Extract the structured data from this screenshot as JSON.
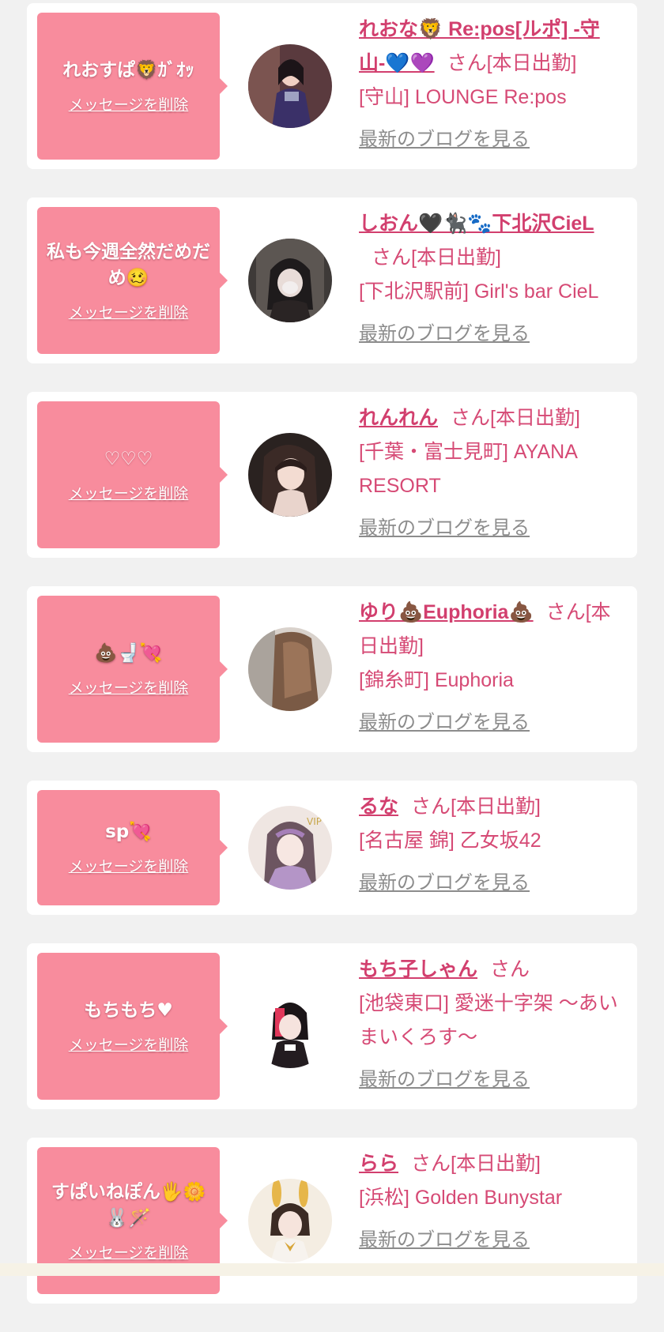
{
  "colors": {
    "bubble": "#f88c9d",
    "accent_pink": "#d64a75",
    "blog_link": "#8c8c8c",
    "card": "#ffffff",
    "page_bg": "#f1f1f1"
  },
  "delete_label": "メッセージを削除",
  "blog_label": "最新のブログを見る",
  "san_label": "さん",
  "cards": [
    {
      "message": "れおすぱ🦁ｶﾞｵｯ",
      "name": "れおな🦁 Re:pos[ルポ] -守山-💙💜",
      "status": "[本日出勤]",
      "shop": "[守山] LOUNGE Re:pos",
      "avatar_icon": "cast-photo-icon"
    },
    {
      "message": "私も今週全然だめだめ🥴",
      "name": "しおん🖤🐈‍⬛🐾下北沢CieL",
      "status": "[本日出勤]",
      "shop": "[下北沢駅前] Girl's bar CieL",
      "avatar_icon": "cast-photo-icon"
    },
    {
      "message": "♡♡♡",
      "name": "れんれん",
      "status": "[本日出勤]",
      "shop": "[千葉・富士見町] AYANA RESORT",
      "avatar_icon": "cast-photo-icon"
    },
    {
      "message": "💩🚽💘",
      "name": "ゆり💩Euphoria💩",
      "status": "[本日出勤]",
      "shop": "[錦糸町] Euphoria",
      "avatar_icon": "cast-photo-icon"
    },
    {
      "message": "sp💘",
      "name": "るな",
      "status": "[本日出勤]",
      "shop": "[名古屋 錦] 乙女坂42",
      "avatar_icon": "cast-photo-icon"
    },
    {
      "message": "もちもち♥",
      "name": "もち子しゃん",
      "status": "",
      "shop": "[池袋東口] 愛迷十字架 〜あいまいくろす〜",
      "avatar_icon": "cast-photo-icon"
    },
    {
      "message": "すぱいねぽん🖐️🌼🐰🪄",
      "name": "らら",
      "status": "[本日出勤]",
      "shop": "[浜松] Golden Bunystar",
      "avatar_icon": "cast-photo-icon"
    }
  ]
}
